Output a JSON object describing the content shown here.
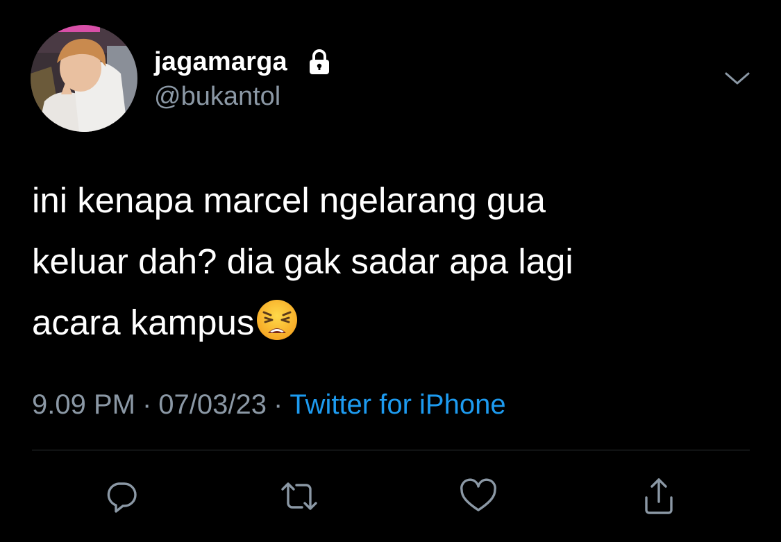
{
  "user": {
    "display_name": "jagamarga",
    "handle": "@bukantol",
    "protected_icon": "lock-icon",
    "avatar": "profile-photo"
  },
  "tweet": {
    "lines": [
      "ini kenapa marcel ngelarang gua",
      "keluar dah? dia gak sadar apa lagi",
      "acara kampus"
    ],
    "emoji": "weary-face"
  },
  "meta": {
    "time": "9.09 PM",
    "separator": "·",
    "date": "07/03/23",
    "source": "Twitter for iPhone"
  },
  "actions": [
    {
      "icon": "reply-icon"
    },
    {
      "icon": "retweet-icon"
    },
    {
      "icon": "like-icon"
    },
    {
      "icon": "share-icon"
    }
  ],
  "colors": {
    "background": "#000000",
    "text": "#ffffff",
    "secondary": "#8b98a5",
    "link": "#1d9bf0",
    "divider": "#2f3336"
  }
}
